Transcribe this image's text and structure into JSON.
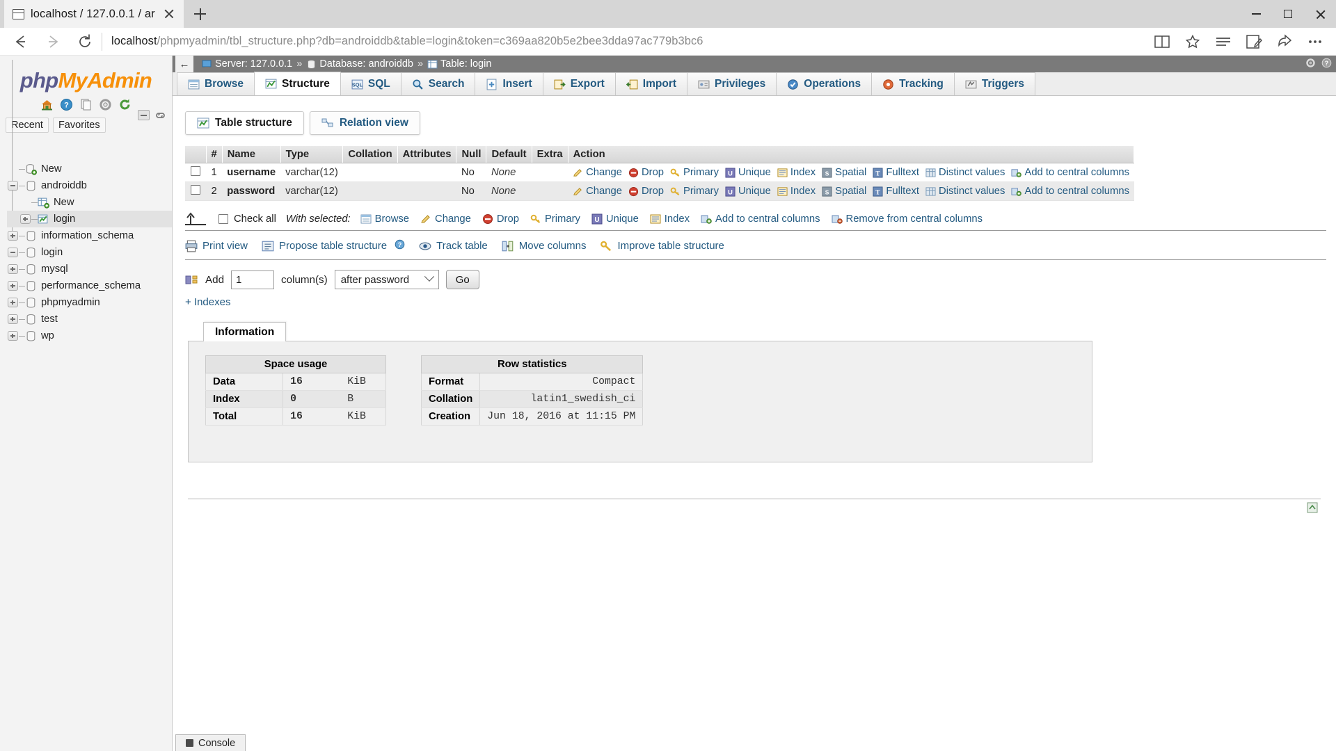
{
  "browser": {
    "tab_title": "localhost / 127.0.0.1 / ar",
    "url_host": "localhost",
    "url_path": "/phpmyadmin/tbl_structure.php?db=androiddb&table=login&token=c369aa820b5e2bee3dda97ac779b3bc6",
    "new_tab_label": "+",
    "back_label": "←",
    "forward_label": "→",
    "reload_label": "⟳"
  },
  "sidebar": {
    "logo_part1": "php",
    "logo_part2": "MyAdmin",
    "icons": [
      "home-icon",
      "help-icon",
      "docs-icon",
      "settings-icon",
      "reload-icon"
    ],
    "quick_tabs": [
      {
        "label": "Recent"
      },
      {
        "label": "Favorites"
      }
    ],
    "tree": [
      {
        "label": "New",
        "icon": "db-new-icon",
        "level": 0,
        "expander": "none",
        "selected": false
      },
      {
        "label": "androiddb",
        "icon": "db-icon",
        "level": 0,
        "expander": "minus",
        "selected": false
      },
      {
        "label": "New",
        "icon": "table-new-icon",
        "level": 2,
        "expander": "none",
        "selected": false
      },
      {
        "label": "login",
        "icon": "table-struct-icon",
        "level": 1,
        "expander": "plus",
        "selected": true
      },
      {
        "label": "information_schema",
        "icon": "db-icon",
        "level": 0,
        "expander": "plus",
        "selected": false
      },
      {
        "label": "login",
        "icon": "db-icon",
        "level": 0,
        "expander": "minus",
        "selected": false
      },
      {
        "label": "mysql",
        "icon": "db-icon",
        "level": 0,
        "expander": "plus",
        "selected": false
      },
      {
        "label": "performance_schema",
        "icon": "db-icon",
        "level": 0,
        "expander": "plus",
        "selected": false
      },
      {
        "label": "phpmyadmin",
        "icon": "db-icon",
        "level": 0,
        "expander": "plus",
        "selected": false
      },
      {
        "label": "test",
        "icon": "db-icon",
        "level": 0,
        "expander": "plus",
        "selected": false
      },
      {
        "label": "wp",
        "icon": "db-icon",
        "level": 0,
        "expander": "plus",
        "selected": false
      }
    ]
  },
  "breadcrumb": {
    "back_arrow": "←",
    "server_label": "Server: 127.0.0.1",
    "database_label": "Database: androiddb",
    "table_label": "Table: login",
    "separator": "»"
  },
  "main_tabs": [
    {
      "label": "Browse",
      "icon": "browse-icon",
      "active": false
    },
    {
      "label": "Structure",
      "icon": "structure-icon",
      "active": true
    },
    {
      "label": "SQL",
      "icon": "sql-icon",
      "active": false
    },
    {
      "label": "Search",
      "icon": "search-icon",
      "active": false
    },
    {
      "label": "Insert",
      "icon": "insert-icon",
      "active": false
    },
    {
      "label": "Export",
      "icon": "export-icon",
      "active": false
    },
    {
      "label": "Import",
      "icon": "import-icon",
      "active": false
    },
    {
      "label": "Privileges",
      "icon": "privileges-icon",
      "active": false
    },
    {
      "label": "Operations",
      "icon": "operations-icon",
      "active": false
    },
    {
      "label": "Tracking",
      "icon": "tracking-icon",
      "active": false
    },
    {
      "label": "Triggers",
      "icon": "triggers-icon",
      "active": false
    }
  ],
  "view_tabs": [
    {
      "label": "Table structure",
      "icon": "table-structure-icon",
      "active": true
    },
    {
      "label": "Relation view",
      "icon": "relation-view-icon",
      "active": false
    }
  ],
  "structure_table": {
    "headers": [
      "#",
      "Name",
      "Type",
      "Collation",
      "Attributes",
      "Null",
      "Default",
      "Extra",
      "Action"
    ],
    "rows": [
      {
        "num": "1",
        "name": "username",
        "type": "varchar(12)",
        "collation": "",
        "attributes": "",
        "null": "No",
        "default": "None",
        "extra": "",
        "actions": [
          {
            "label": "Change",
            "icon": "pencil-icon"
          },
          {
            "label": "Drop",
            "icon": "drop-icon"
          },
          {
            "label": "Primary",
            "icon": "key-icon"
          },
          {
            "label": "Unique",
            "icon": "unique-icon"
          },
          {
            "label": "Index",
            "icon": "index-icon"
          },
          {
            "label": "Spatial",
            "icon": "spatial-icon"
          },
          {
            "label": "Fulltext",
            "icon": "fulltext-icon"
          },
          {
            "label": "Distinct values",
            "icon": "distinct-icon"
          },
          {
            "label": "Add to central columns",
            "icon": "central-columns-icon"
          }
        ]
      },
      {
        "num": "2",
        "name": "password",
        "type": "varchar(12)",
        "collation": "",
        "attributes": "",
        "null": "No",
        "default": "None",
        "extra": "",
        "actions": [
          {
            "label": "Change",
            "icon": "pencil-icon"
          },
          {
            "label": "Drop",
            "icon": "drop-icon"
          },
          {
            "label": "Primary",
            "icon": "key-icon"
          },
          {
            "label": "Unique",
            "icon": "unique-icon"
          },
          {
            "label": "Index",
            "icon": "index-icon"
          },
          {
            "label": "Spatial",
            "icon": "spatial-icon"
          },
          {
            "label": "Fulltext",
            "icon": "fulltext-icon"
          },
          {
            "label": "Distinct values",
            "icon": "distinct-icon"
          },
          {
            "label": "Add to central columns",
            "icon": "central-columns-icon"
          }
        ]
      }
    ]
  },
  "with_selected": {
    "check_all_label": "Check all",
    "prefix_label": "With selected:",
    "actions": [
      {
        "label": "Browse",
        "icon": "browse-icon"
      },
      {
        "label": "Change",
        "icon": "pencil-icon"
      },
      {
        "label": "Drop",
        "icon": "drop-icon"
      },
      {
        "label": "Primary",
        "icon": "key-icon"
      },
      {
        "label": "Unique",
        "icon": "unique-icon"
      },
      {
        "label": "Index",
        "icon": "index-icon"
      },
      {
        "label": "Add to central columns",
        "icon": "central-columns-icon"
      },
      {
        "label": "Remove from central columns",
        "icon": "remove-central-icon"
      }
    ]
  },
  "tools": [
    {
      "label": "Print view",
      "icon": "print-icon"
    },
    {
      "label": "Propose table structure",
      "icon": "propose-icon",
      "has_help": true
    },
    {
      "label": "Track table",
      "icon": "track-icon"
    },
    {
      "label": "Move columns",
      "icon": "move-columns-icon"
    },
    {
      "label": "Improve table structure",
      "icon": "improve-icon"
    }
  ],
  "add_column": {
    "add_label": "Add",
    "count_value": "1",
    "columns_label": "column(s)",
    "position_value": "after password",
    "go_label": "Go"
  },
  "indexes_link": "+ Indexes",
  "information": {
    "tab_label": "Information",
    "space_usage": {
      "title": "Space usage",
      "rows": [
        {
          "label": "Data",
          "value": "16",
          "unit": "KiB"
        },
        {
          "label": "Index",
          "value": "0",
          "unit": "B"
        },
        {
          "label": "Total",
          "value": "16",
          "unit": "KiB"
        }
      ]
    },
    "row_statistics": {
      "title": "Row statistics",
      "rows": [
        {
          "label": "Format",
          "value": "Compact"
        },
        {
          "label": "Collation",
          "value": "latin1_swedish_ci"
        },
        {
          "label": "Creation",
          "value": "Jun 18, 2016 at 11:15 PM"
        }
      ]
    }
  },
  "console": {
    "label": "Console",
    "icon": "console-icon"
  }
}
